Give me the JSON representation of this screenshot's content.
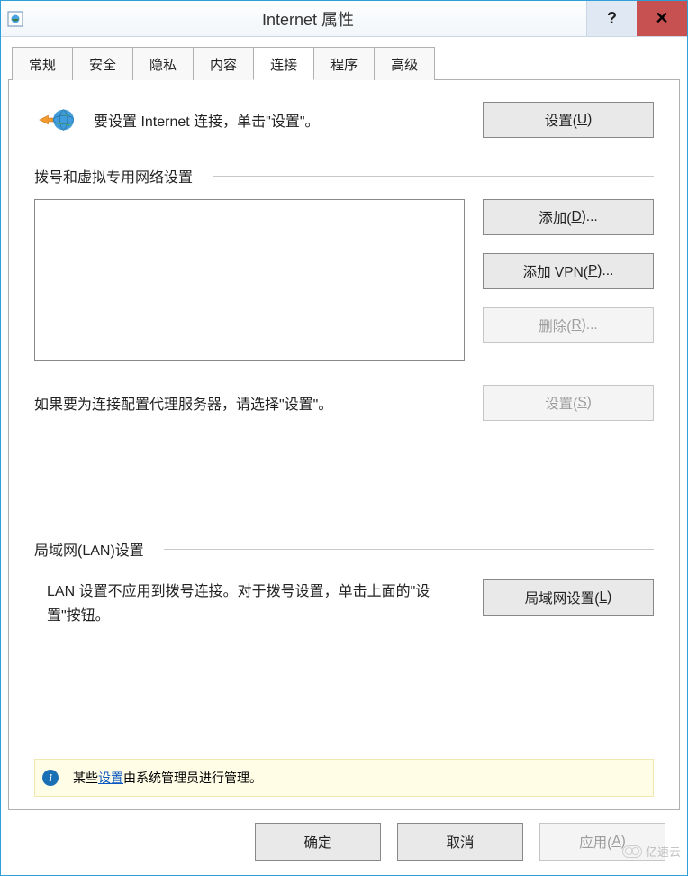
{
  "title": "Internet 属性",
  "tabs": {
    "general": "常规",
    "security": "安全",
    "privacy": "隐私",
    "content": "内容",
    "connections": "连接",
    "programs": "程序",
    "advanced": "高级"
  },
  "intro": {
    "text": "要设置 Internet 连接，单击\"设置\"。",
    "setup_btn": "设置(U)",
    "setup_accel": "U"
  },
  "dialup": {
    "section_title": "拨号和虚拟专用网络设置",
    "add_btn": "添加(D)...",
    "add_accel": "D",
    "add_vpn_btn": "添加 VPN(P)...",
    "add_vpn_accel": "P",
    "delete_btn": "删除(R)...",
    "delete_accel": "R",
    "proxy_text": "如果要为连接配置代理服务器，请选择\"设置\"。",
    "settings_btn": "设置(S)",
    "settings_accel": "S"
  },
  "lan": {
    "section_title": "局域网(LAN)设置",
    "text": "LAN 设置不应用到拨号连接。对于拨号设置，单击上面的\"设置\"按钮。",
    "lan_btn": "局域网设置(L)",
    "lan_accel": "L"
  },
  "info": {
    "prefix": "某些",
    "link": "设置",
    "suffix": "由系统管理员进行管理。"
  },
  "footer": {
    "ok": "确定",
    "cancel": "取消",
    "apply": "应用(A)",
    "apply_accel": "A"
  },
  "watermark": "亿速云"
}
